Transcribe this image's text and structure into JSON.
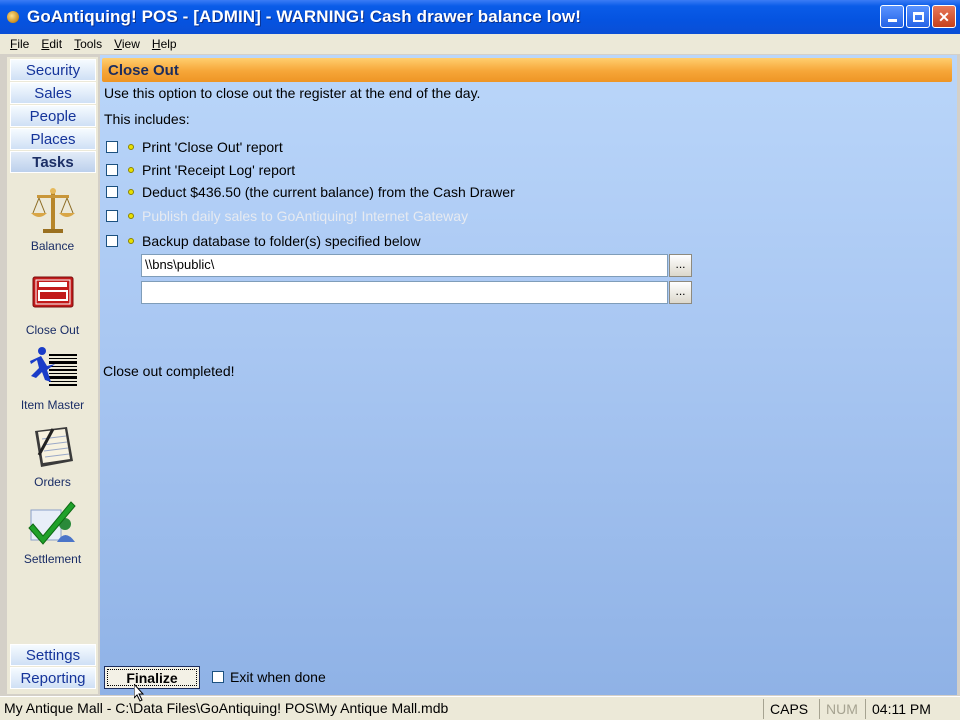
{
  "window": {
    "title": "GoAntiquing! POS - [ADMIN] - WARNING! Cash drawer balance low!",
    "icon": "app-icon"
  },
  "menu": [
    {
      "label": "File",
      "accel": "F",
      "rest": "ile"
    },
    {
      "label": "Edit",
      "accel": "E",
      "rest": "dit"
    },
    {
      "label": "Tools",
      "accel": "T",
      "rest": "ools"
    },
    {
      "label": "View",
      "accel": "V",
      "rest": "iew"
    },
    {
      "label": "Help",
      "accel": "H",
      "rest": "elp"
    }
  ],
  "nav": {
    "sections": [
      "Security",
      "Sales",
      "People",
      "Places",
      "Tasks"
    ],
    "active": "Tasks",
    "tasks": [
      {
        "label": "Balance",
        "icon": "scales-icon"
      },
      {
        "label": "Close Out",
        "icon": "closed-sign-icon"
      },
      {
        "label": "Item Master",
        "icon": "running-man-barcode-icon"
      },
      {
        "label": "Orders",
        "icon": "notebook-pen-icon"
      },
      {
        "label": "Settlement",
        "icon": "checkmark-person-icon"
      }
    ],
    "bottom": [
      "Settings",
      "Reporting"
    ]
  },
  "main": {
    "header": "Close Out",
    "intro": "Use this option to close out the register at the end of the day.",
    "includes_label": "This includes:",
    "options": [
      {
        "label": "Print 'Close Out' report",
        "checked": false,
        "enabled": true
      },
      {
        "label": "Print 'Receipt Log' report",
        "checked": false,
        "enabled": true
      },
      {
        "label": "Deduct $436.50 (the current balance) from the Cash Drawer",
        "checked": false,
        "enabled": true
      },
      {
        "label": "Publish daily sales to GoAntiquing! Internet Gateway",
        "checked": false,
        "enabled": false
      },
      {
        "label": "Backup database to folder(s) specified below",
        "checked": false,
        "enabled": true
      }
    ],
    "backup_paths": [
      "\\\\bns\\public\\",
      ""
    ],
    "browse_label": "...",
    "status_message": "Close out completed!",
    "finalize_label": "Finalize",
    "exit_label": "Exit when done"
  },
  "statusbar": {
    "path": "My Antique Mall - C:\\Data Files\\GoAntiquing! POS\\My Antique Mall.mdb",
    "caps": "CAPS",
    "num": "NUM",
    "time": "04:11 PM"
  }
}
